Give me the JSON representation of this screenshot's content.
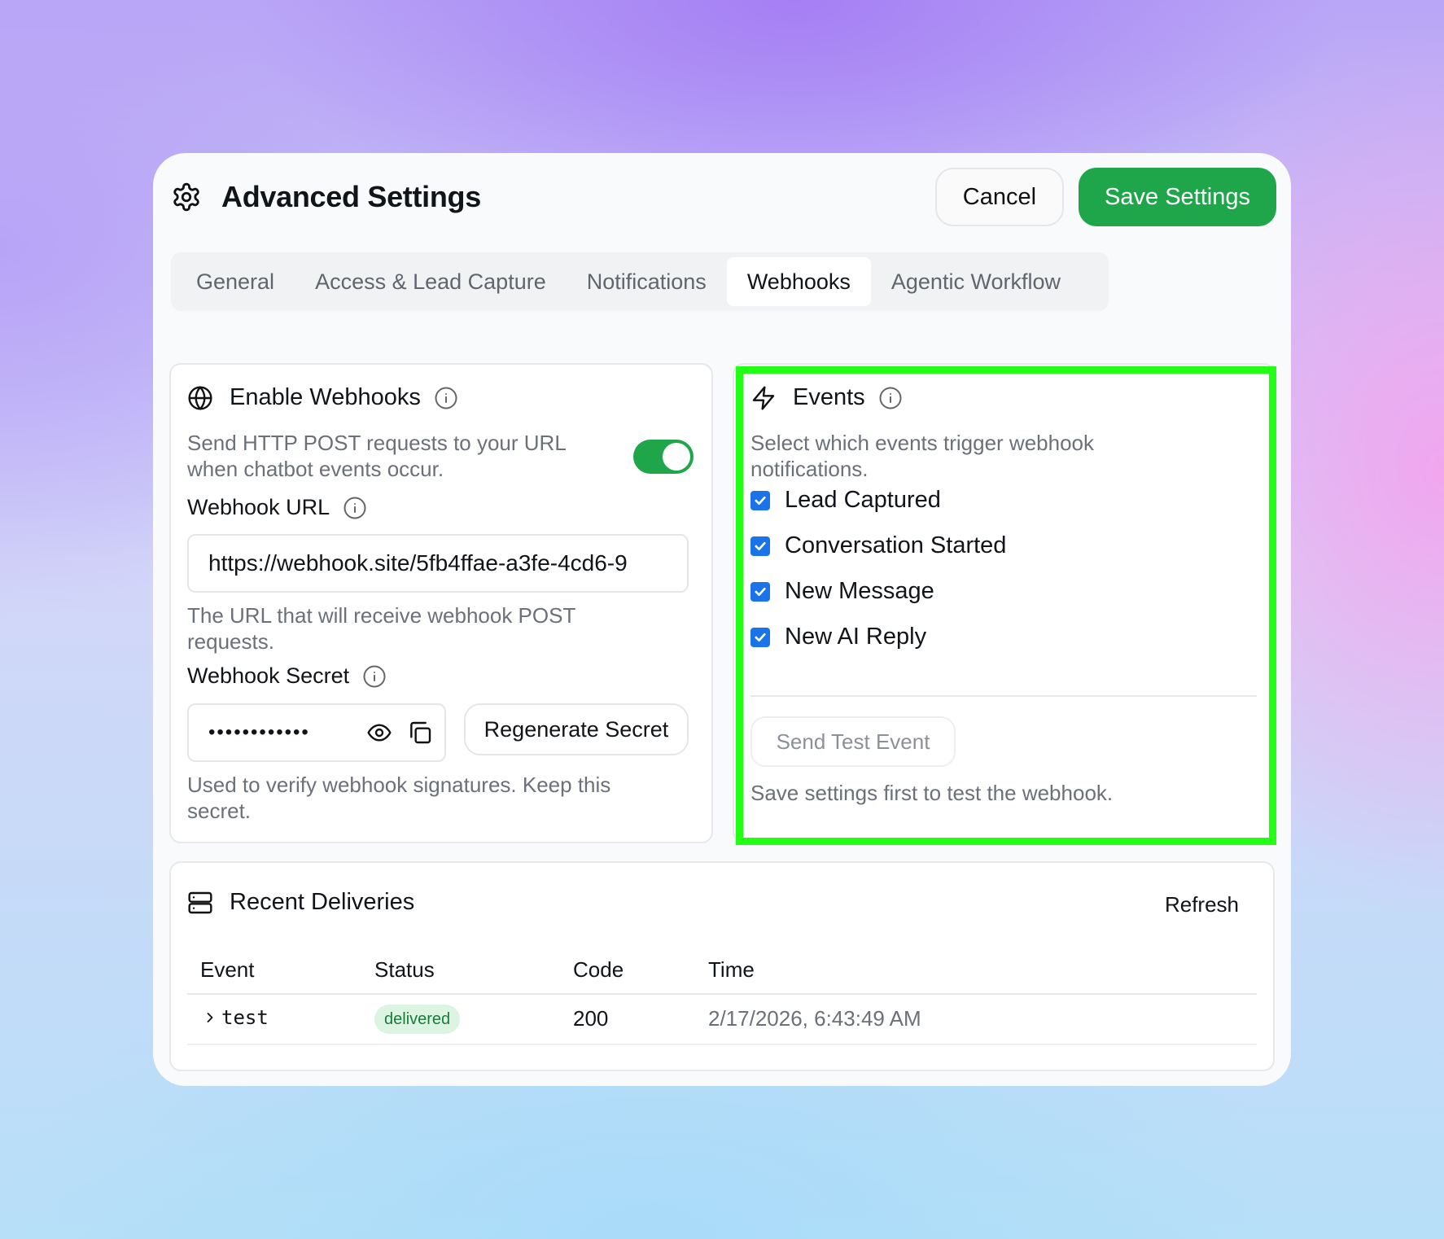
{
  "header": {
    "title": "Advanced Settings",
    "cancel_label": "Cancel",
    "save_label": "Save Settings"
  },
  "tabs": [
    {
      "label": "General",
      "active": false
    },
    {
      "label": "Access & Lead Capture",
      "active": false
    },
    {
      "label": "Notifications",
      "active": false
    },
    {
      "label": "Webhooks",
      "active": true
    },
    {
      "label": "Agentic Workflow",
      "active": false
    }
  ],
  "webhooks": {
    "title": "Enable Webhooks",
    "description": "Send HTTP POST requests to your URL when chatbot events occur.",
    "enabled": true,
    "url_label": "Webhook URL",
    "url_value": "https://webhook.site/5fb4ffae-a3fe-4cd6-9",
    "url_help": "The URL that will receive webhook POST requests.",
    "secret_label": "Webhook Secret",
    "secret_value": "••••••••••••",
    "regenerate_label": "Regenerate Secret",
    "secret_help": "Used to verify webhook signatures. Keep this secret."
  },
  "events": {
    "title": "Events",
    "description": "Select which events trigger webhook notifications.",
    "items": [
      {
        "label": "Lead Captured",
        "checked": true
      },
      {
        "label": "Conversation Started",
        "checked": true
      },
      {
        "label": "New Message",
        "checked": true
      },
      {
        "label": "New AI Reply",
        "checked": true
      }
    ],
    "test_button_label": "Send Test Event",
    "test_help": "Save settings first to test the webhook."
  },
  "deliveries": {
    "title": "Recent Deliveries",
    "refresh_label": "Refresh",
    "columns": [
      "Event",
      "Status",
      "Code",
      "Time"
    ],
    "rows": [
      {
        "event": "test",
        "status": "delivered",
        "code": "200",
        "time": "2/17/2026, 6:43:49 AM"
      }
    ]
  },
  "colors": {
    "accent_green": "#1fa64a",
    "checkbox_blue": "#1a73e8",
    "highlight_green": "#22ff15"
  }
}
